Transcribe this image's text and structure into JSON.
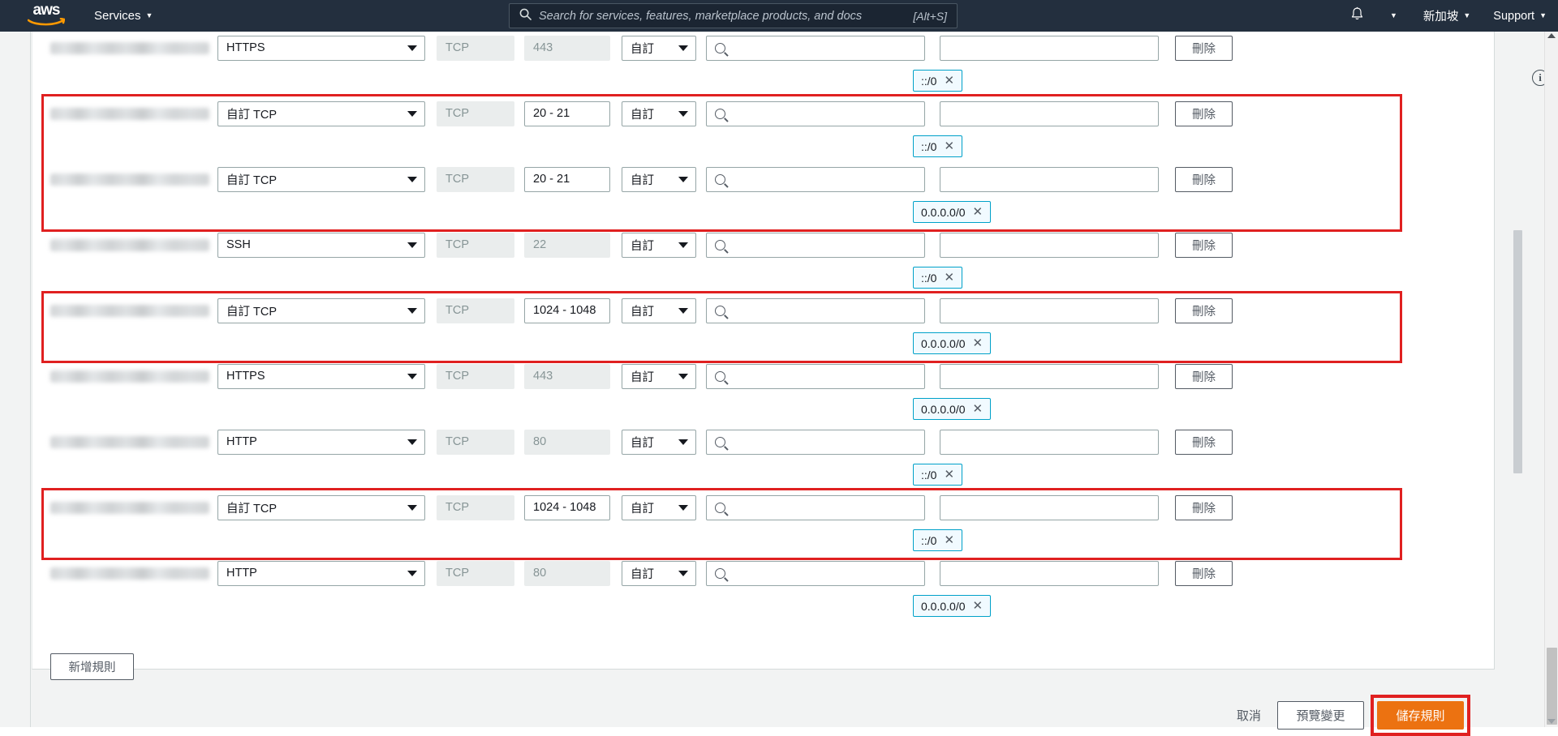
{
  "topnav": {
    "logo_text": "aws",
    "services_label": "Services",
    "caret": "▼",
    "search": {
      "icon": "search-icon",
      "placeholder": "Search for services, features, marketplace products, and docs",
      "shortcut": "[Alt+S]"
    },
    "bell_icon": "bell-icon",
    "account_caret": "▼",
    "region_label": "新加坡",
    "support_label": "Support"
  },
  "card": {
    "add_rule_label": "新增規則",
    "info_icon": "info-icon"
  },
  "common": {
    "delete_label": "刪除",
    "protocol_tcp": "TCP",
    "source_custom": "自訂",
    "search_icon": "search-icon",
    "chip_remove_icon": "✕",
    "caret": "▼"
  },
  "rules": [
    {
      "id": "rule-1",
      "sg_id_blurred": true,
      "type": "HTTPS",
      "protocol": "TCP",
      "port": "443",
      "port_editable": false,
      "source_type": "自訂",
      "source_value": "",
      "description": "",
      "cidr_chip": "::/0",
      "highlighted": false,
      "partial_top": true
    },
    {
      "id": "rule-2",
      "sg_id_blurred": true,
      "type": "自訂 TCP",
      "protocol": "TCP",
      "port": "20 - 21",
      "port_editable": true,
      "source_type": "自訂",
      "source_value": "",
      "description": "",
      "cidr_chip": "::/0",
      "highlighted": true
    },
    {
      "id": "rule-3",
      "sg_id_blurred": true,
      "type": "自訂 TCP",
      "protocol": "TCP",
      "port": "20 - 21",
      "port_editable": true,
      "source_type": "自訂",
      "source_value": "",
      "description": "",
      "cidr_chip": "0.0.0.0/0",
      "highlighted": true
    },
    {
      "id": "rule-4",
      "sg_id_blurred": true,
      "type": "SSH",
      "protocol": "TCP",
      "port": "22",
      "port_editable": false,
      "source_type": "自訂",
      "source_value": "",
      "description": "",
      "cidr_chip": "::/0",
      "highlighted": false
    },
    {
      "id": "rule-5",
      "sg_id_blurred": true,
      "type": "自訂 TCP",
      "protocol": "TCP",
      "port": "1024 - 1048",
      "port_editable": true,
      "source_type": "自訂",
      "source_value": "",
      "description": "",
      "cidr_chip": "0.0.0.0/0",
      "highlighted": true
    },
    {
      "id": "rule-6",
      "sg_id_blurred": true,
      "type": "HTTPS",
      "protocol": "TCP",
      "port": "443",
      "port_editable": false,
      "source_type": "自訂",
      "source_value": "",
      "description": "",
      "cidr_chip": "0.0.0.0/0",
      "highlighted": false
    },
    {
      "id": "rule-7",
      "sg_id_blurred": true,
      "type": "HTTP",
      "protocol": "TCP",
      "port": "80",
      "port_editable": false,
      "source_type": "自訂",
      "source_value": "",
      "description": "",
      "cidr_chip": "::/0",
      "highlighted": false
    },
    {
      "id": "rule-8",
      "sg_id_blurred": true,
      "type": "自訂 TCP",
      "protocol": "TCP",
      "port": "1024 - 1048",
      "port_editable": true,
      "source_type": "自訂",
      "source_value": "",
      "description": "",
      "cidr_chip": "::/0",
      "highlighted": true
    },
    {
      "id": "rule-9",
      "sg_id_blurred": true,
      "type": "HTTP",
      "protocol": "TCP",
      "port": "80",
      "port_editable": false,
      "source_type": "自訂",
      "source_value": "",
      "description": "",
      "cidr_chip": "0.0.0.0/0",
      "highlighted": false
    }
  ],
  "highlight_groups": [
    {
      "name": "highlight-group-1",
      "rule_ids": [
        "rule-2",
        "rule-3"
      ]
    },
    {
      "name": "highlight-group-2",
      "rule_ids": [
        "rule-5"
      ]
    },
    {
      "name": "highlight-group-3",
      "rule_ids": [
        "rule-8"
      ]
    },
    {
      "name": "highlight-save-button",
      "rule_ids": []
    }
  ],
  "footer": {
    "cancel_label": "取消",
    "preview_label": "預覽變更",
    "save_label": "儲存規則"
  },
  "colors": {
    "nav_bg": "#232f3e",
    "accent_orange": "#ec7211",
    "highlight_red": "#e02020",
    "chip_border": "#00a1c9",
    "chip_bg": "#f1faff",
    "page_bg": "#f2f3f3",
    "readonly_bg": "#eaeded"
  }
}
